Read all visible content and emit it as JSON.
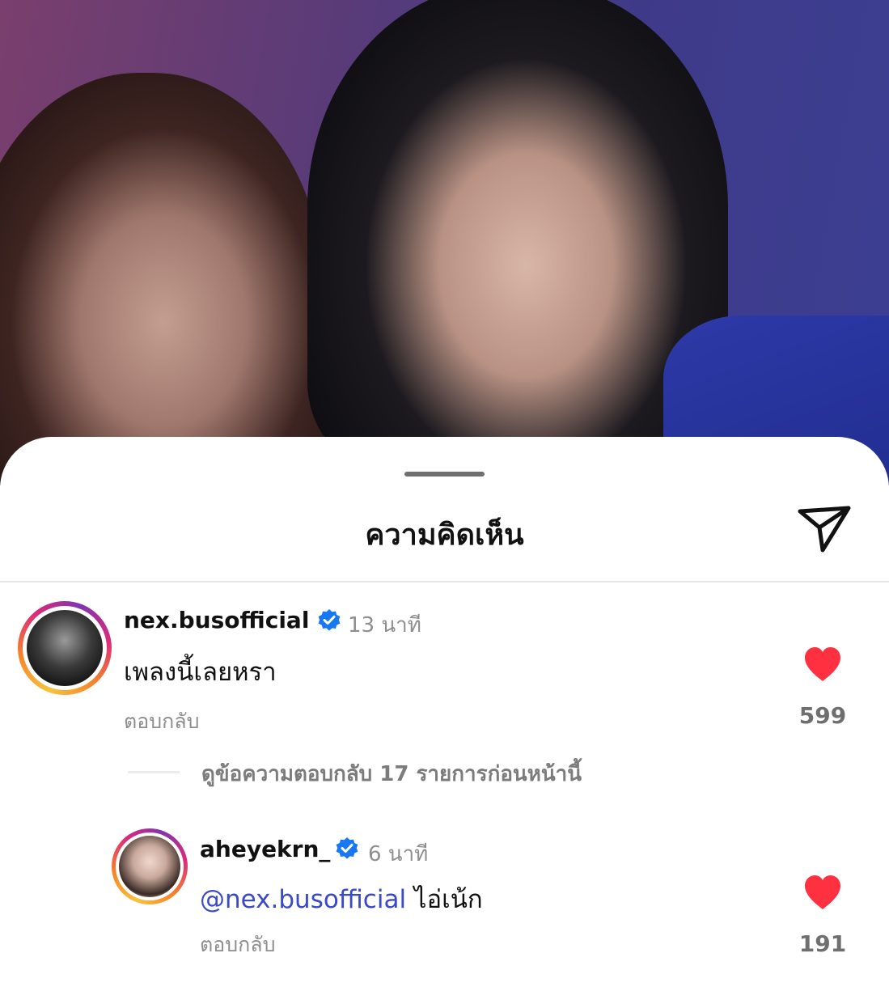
{
  "sheet": {
    "title": "ความคิดเห็น"
  },
  "comments": [
    {
      "username": "nex.busofficial",
      "verified": true,
      "time": "13 นาที",
      "text": "เพลงนี้เลยหรา",
      "reply_label": "ตอบกลับ",
      "likes": "599",
      "view_replies": "ดูข้อความตอบกลับ 17 รายการก่อนหน้านี้"
    },
    {
      "username": "aheyekrn_",
      "verified": true,
      "time": "6 นาที",
      "mention": "@nex.busofficial",
      "text": " ไอ่เน้ก",
      "reply_label": "ตอบกลับ",
      "likes": "191"
    }
  ],
  "colors": {
    "heart": "#ff3040",
    "verified": "#1877f2",
    "mention": "#3a49c8"
  },
  "icons": {
    "send": "paper-plane-outline",
    "like": "heart-filled",
    "verified": "verified-badge"
  }
}
